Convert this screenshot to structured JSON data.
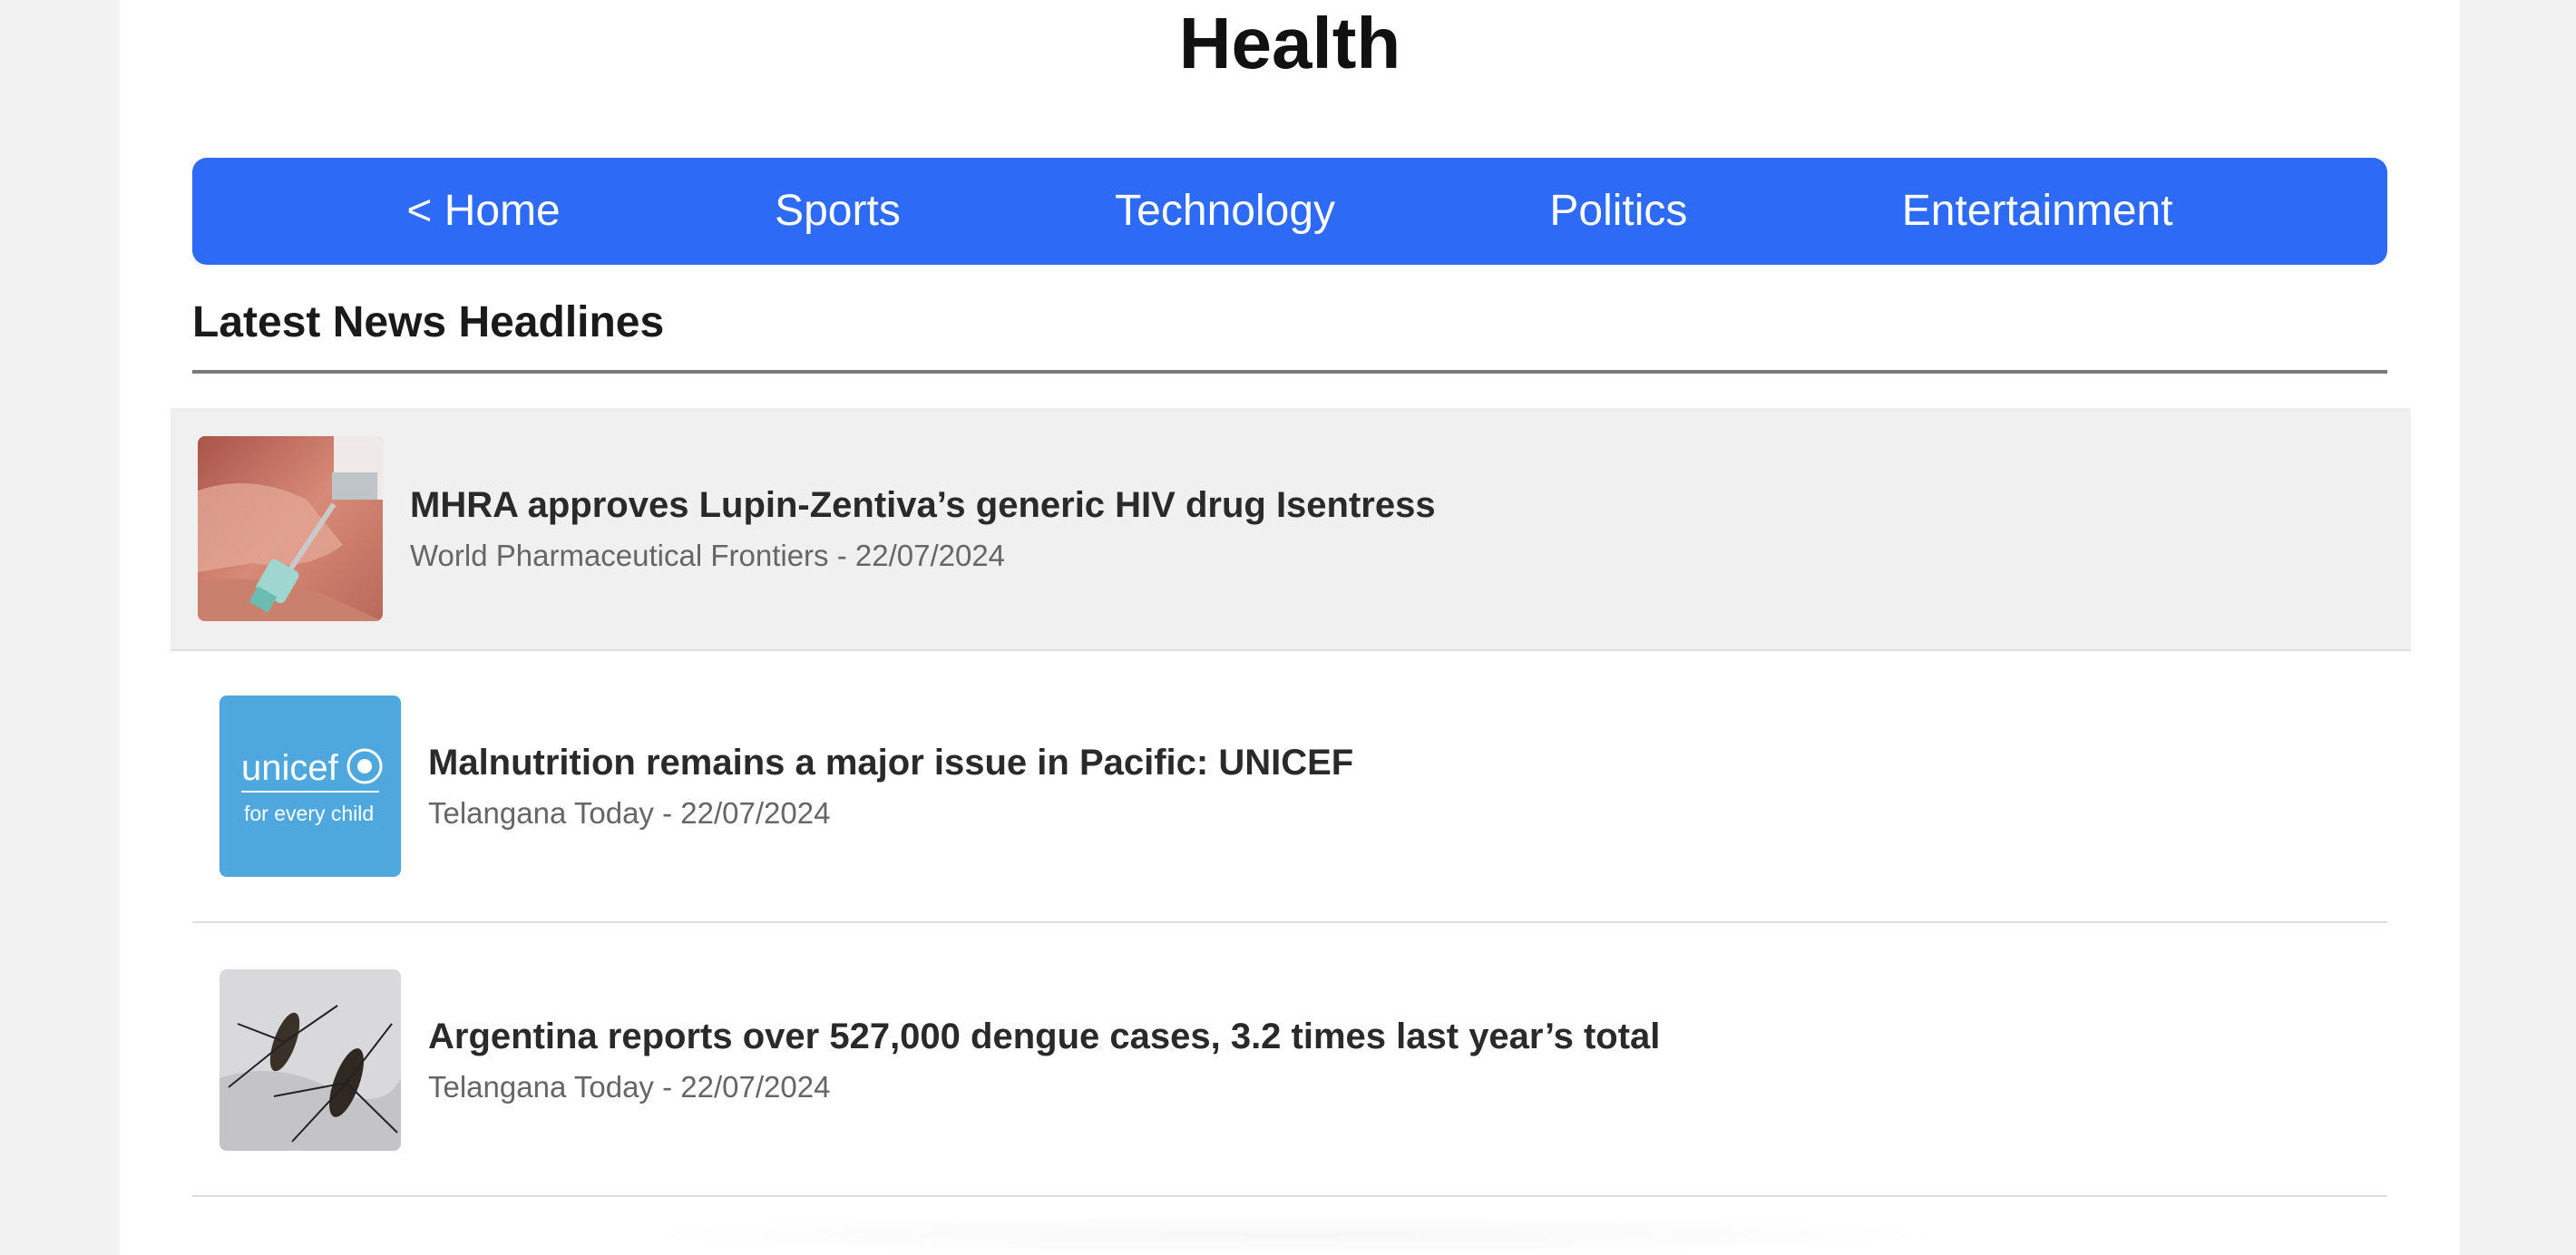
{
  "page": {
    "title": "Health"
  },
  "nav": {
    "items": [
      {
        "label": "< Home"
      },
      {
        "label": "Sports"
      },
      {
        "label": "Technology"
      },
      {
        "label": "Politics"
      },
      {
        "label": "Entertainment"
      }
    ]
  },
  "section": {
    "title": "Latest News Headlines"
  },
  "news": [
    {
      "headline": "MHRA approves Lupin-Zentiva’s generic HIV drug Isentress",
      "source": "World Pharmaceutical Frontiers",
      "date": "22/07/2024",
      "meta": "World Pharmaceutical Frontiers - 22/07/2024",
      "image": "syringe-vial-photo"
    },
    {
      "headline": "Malnutrition remains a major issue in Pacific: UNICEF",
      "source": "Telangana Today",
      "date": "22/07/2024",
      "meta": "Telangana Today - 22/07/2024",
      "image": "unicef-logo",
      "logo_text": "unicef",
      "logo_tagline": "for every child"
    },
    {
      "headline": "Argentina reports over 527,000 dengue cases, 3.2 times last year’s total",
      "source": "Telangana Today",
      "date": "22/07/2024",
      "meta": "Telangana Today - 22/07/2024",
      "image": "mosquito-photo"
    }
  ],
  "colors": {
    "nav_background": "#2d6af5",
    "highlight_row": "#f0f0f0",
    "unicef_blue": "#4ea8de"
  }
}
